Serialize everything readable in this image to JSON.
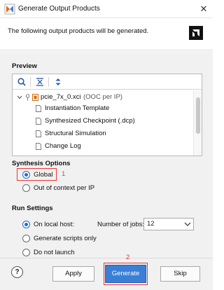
{
  "window": {
    "title": "Generate Output Products",
    "close_glyph": "✕"
  },
  "header": {
    "description": "The following output products will be generated."
  },
  "preview": {
    "title": "Preview",
    "toolbar": [
      "search-icon",
      "collapse-all-icon",
      "expand-all-icon"
    ],
    "tree": [
      {
        "name": "pcie_7x_0.xci",
        "suffix": "(OOC per IP)"
      },
      {
        "name": "Instantiation Template"
      },
      {
        "name": "Synthesized Checkpoint (.dcp)"
      },
      {
        "name": "Structural Simulation"
      },
      {
        "name": "Change Log"
      }
    ]
  },
  "synthesis": {
    "title": "Synthesis Options",
    "options": [
      {
        "label": "Global",
        "selected": true
      },
      {
        "label": "Out of context per IP",
        "selected": false
      }
    ],
    "annotation": "1"
  },
  "run": {
    "title": "Run Settings",
    "options": [
      {
        "label": "On local host:",
        "selected": true
      },
      {
        "label": "Generate scripts only",
        "selected": false
      },
      {
        "label": "Do not launch",
        "selected": false
      }
    ],
    "jobs_label": "Number of jobs:",
    "jobs_value": "12"
  },
  "footer": {
    "help": "?",
    "apply": "Apply",
    "generate": "Generate",
    "skip": "Skip",
    "annotation": "2"
  },
  "colors": {
    "accent": "#3a7fd5",
    "annotation": "#e33333",
    "checked_radio": "#1e6cd6"
  }
}
